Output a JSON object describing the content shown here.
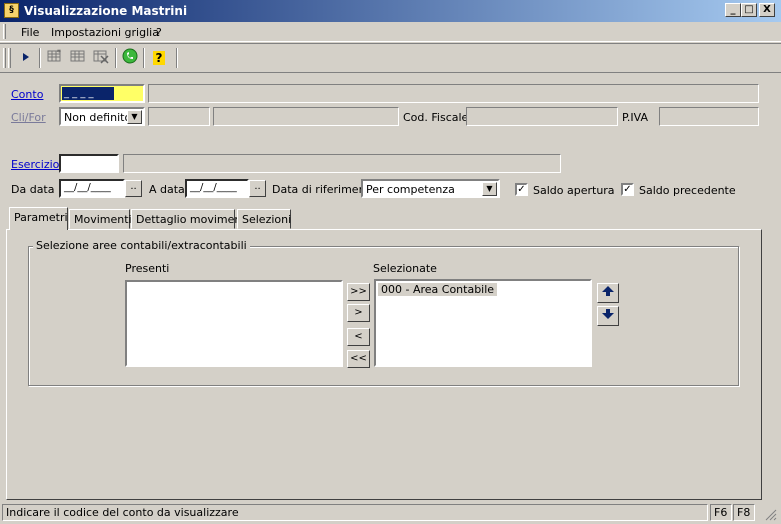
{
  "window": {
    "title": "Visualizzazione Mastrini",
    "controls": {
      "minimize": "_",
      "maximize": "□",
      "close": "X"
    }
  },
  "menu": {
    "items": [
      "File",
      "Impostazioni griglia",
      "?"
    ]
  },
  "toolbar": {
    "icons": [
      "play-icon",
      "grid-add-icon",
      "grid-icon",
      "grid-delete-icon",
      "phone-icon",
      "help-icon"
    ],
    "help_glyph": "?"
  },
  "form": {
    "conto": {
      "label": "Conto",
      "code_value": "_ _ _ _",
      "description": ""
    },
    "cli_for": {
      "label": "Cli/For",
      "selected": "Non definito",
      "code": "",
      "name": ""
    },
    "cod_fiscale": {
      "label": "Cod. Fiscale",
      "value": ""
    },
    "piva": {
      "label": "P.IVA",
      "value": ""
    },
    "esercizio": {
      "label": "Esercizio",
      "code": "",
      "description": ""
    },
    "da_data": {
      "label": "Da data",
      "value": "__/__/____",
      "button": ".."
    },
    "a_data": {
      "label": "A data",
      "value": "__/__/____",
      "button": ".."
    },
    "data_riferimento": {
      "label": "Data di riferimento",
      "selected": "Per competenza"
    },
    "saldo_apertura": {
      "label": "Saldo apertura",
      "checked": true
    },
    "saldo_precedente": {
      "label": "Saldo precedente",
      "checked": true
    }
  },
  "tabs": [
    "Parametri",
    "Movimenti",
    "Dettaglio movimenti",
    "Selezioni"
  ],
  "parametri": {
    "group_title": "Selezione aree contabili/extracontabili",
    "presenti_label": "Presenti",
    "selezionate_label": "Selezionate",
    "presenti_items": [],
    "selezionate_items": [
      "000 - Area Contabile"
    ],
    "move_buttons": [
      ">>",
      ">",
      "<",
      "<<"
    ]
  },
  "statusbar": {
    "message": "Indicare il codice del conto da visualizzare",
    "keys": [
      "F6",
      "F8"
    ]
  },
  "colors": {
    "title_start": "#0a246a",
    "title_end": "#a6caf0",
    "conto_highlight": "#ffff66",
    "face": "#d4d0c8"
  }
}
